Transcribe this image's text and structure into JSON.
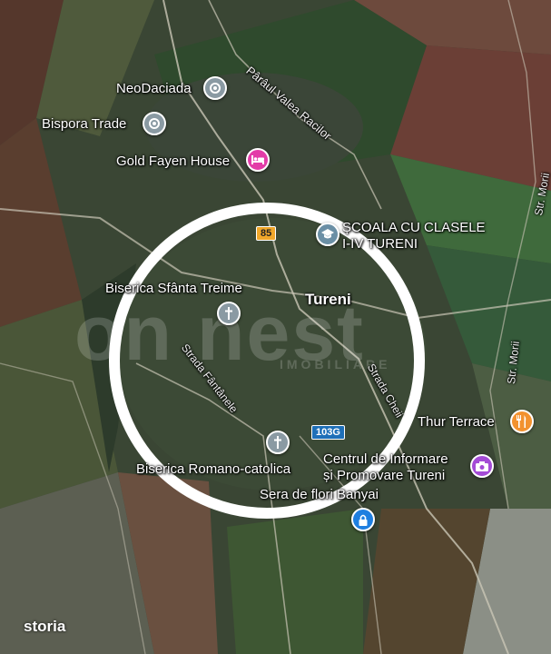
{
  "map": {
    "town": "Tureni",
    "places": {
      "neodaciada": "NeoDaciada",
      "bispora": "Bispora Trade",
      "gold_fayen": "Gold Fayen House",
      "scoala_line1": "ȘCOALA CU CLASELE",
      "scoala_line2": "I-IV TURENI",
      "biserica_treime": "Biserica Sfânta Treime",
      "thur_terrace": "Thur Terrace",
      "centrul_line1": "Centrul de Informare",
      "centrul_line2": "și Promovare Tureni",
      "biserica_romano": "Biserica Romano-catolica",
      "sera": "Sera de flori Banyai"
    },
    "streets": {
      "paraul": "Pârâul Valea Racilor",
      "fantanele": "Strada Fântânele",
      "cheii": "Strada Cheii",
      "morii_top": "Str. Morii",
      "morii_side": "Str. Morii"
    },
    "road_shields": {
      "road_85": "85",
      "road_103g": "103G"
    },
    "watermark": {
      "main": "on nest",
      "sub": "IMOBILIARE"
    },
    "colors": {
      "circle": "#ffffff",
      "pin_grey": "#8a9aa3",
      "pin_magenta": "#e33ca8",
      "pin_orange": "#f2922f",
      "pin_purple": "#a44bd6",
      "pin_blue": "#1e7fe0",
      "pin_school": "#6b8fa5"
    },
    "icons": [
      "circle-dot-icon",
      "hotel-bed-icon",
      "school-icon",
      "cross-icon",
      "fork-knife-icon",
      "camera-icon",
      "lock-icon"
    ]
  },
  "branding": {
    "logo": "storia"
  }
}
